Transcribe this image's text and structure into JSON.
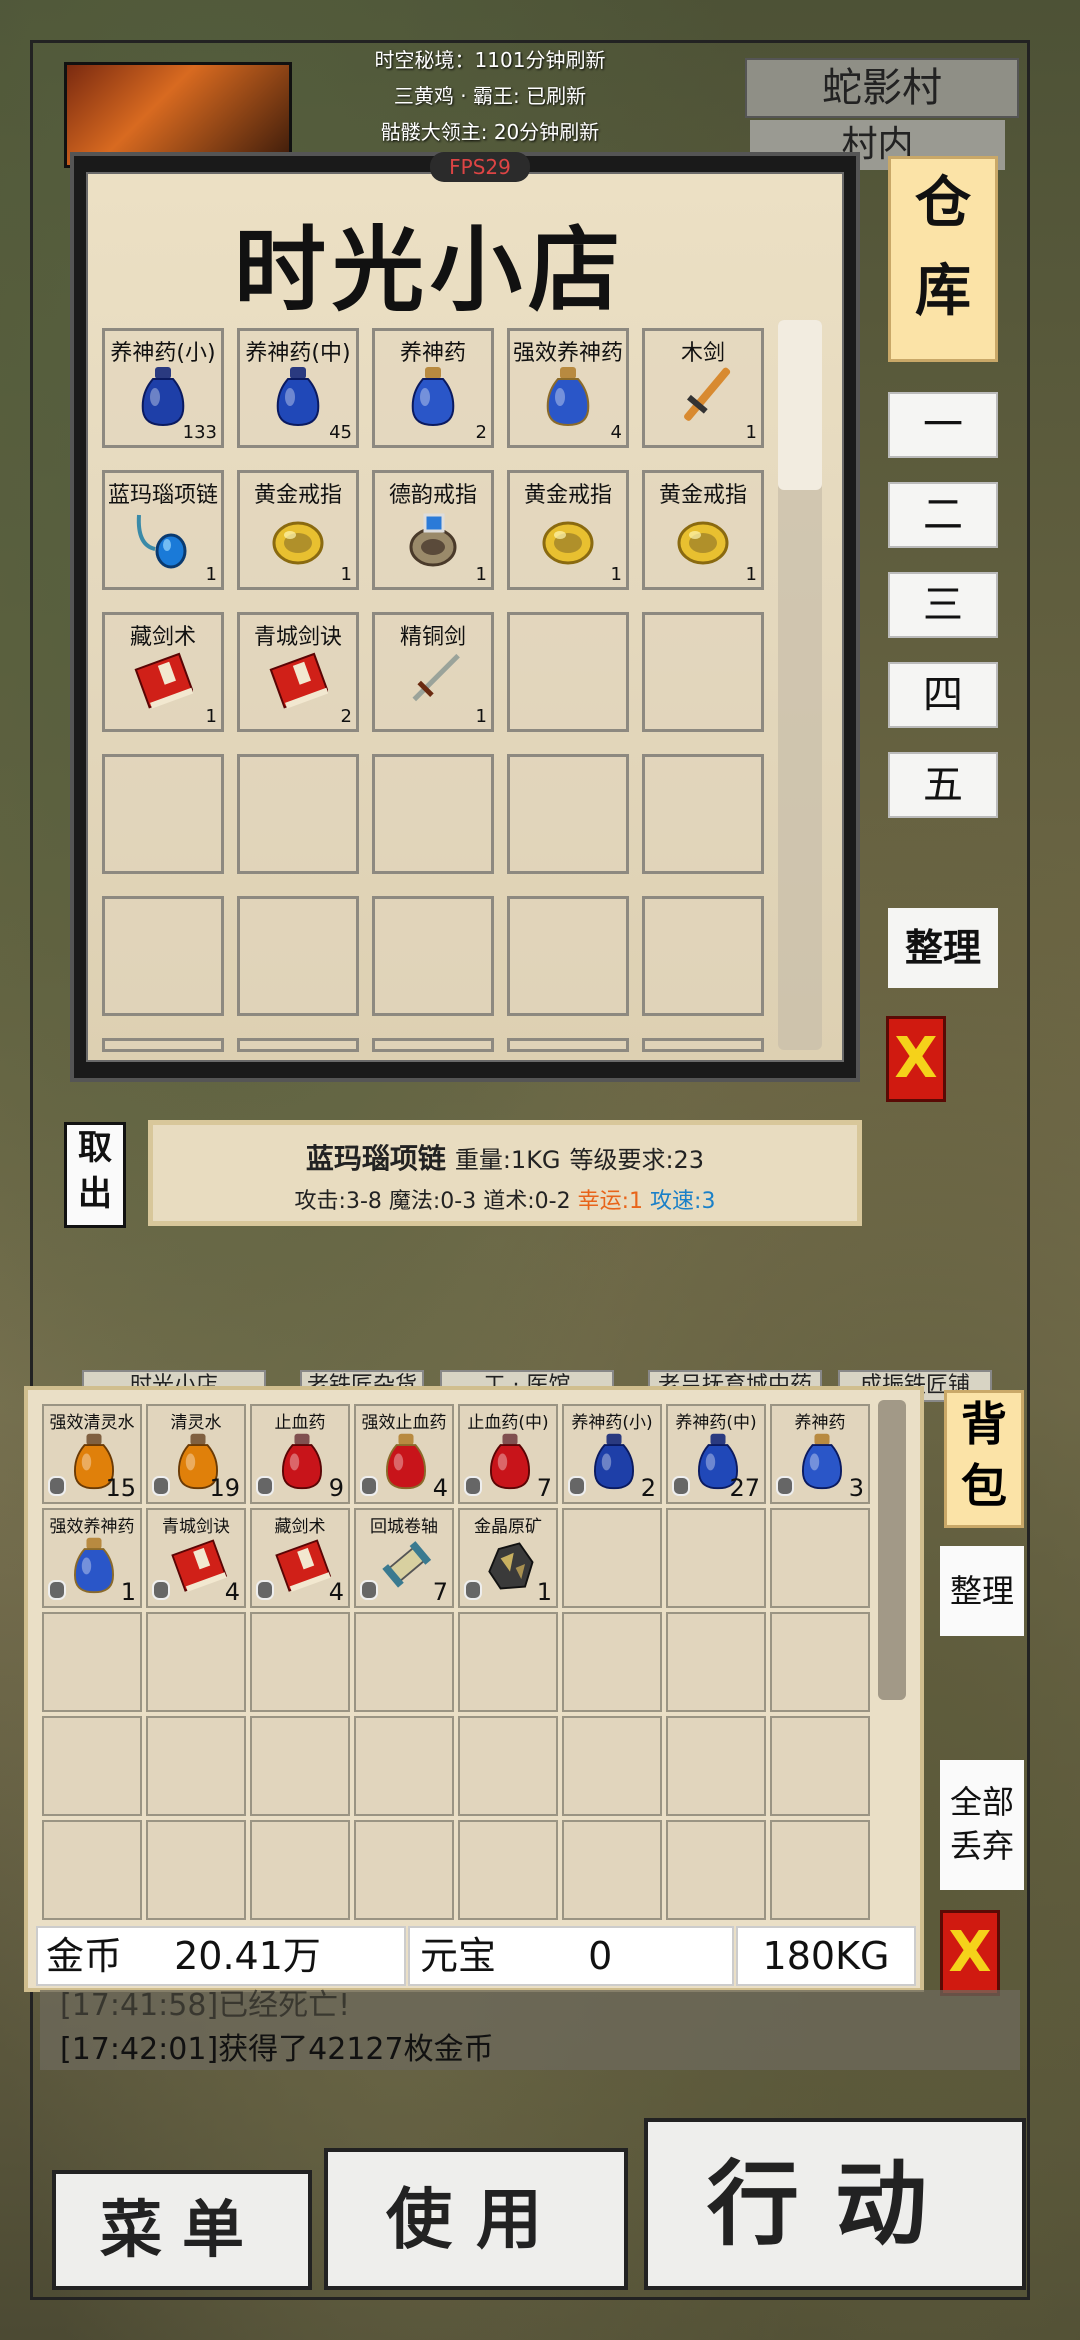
{
  "top": {
    "line1": "时空秘境：1101分钟刷新",
    "line2": "三黄鸡 · 霸王: 已刷新",
    "line3": "骷髅大领主: 20分钟刷新",
    "location": "蛇影村",
    "sub_location": "村内",
    "fps": "FPS29"
  },
  "shop": {
    "title": "时光小店",
    "items": [
      {
        "name": "养神药(小)",
        "count": "133",
        "icon": "blue-potion-small"
      },
      {
        "name": "养神药(中)",
        "count": "45",
        "icon": "blue-potion-medium"
      },
      {
        "name": "养神药",
        "count": "2",
        "icon": "blue-potion"
      },
      {
        "name": "强效养神药",
        "count": "4",
        "icon": "blue-potion-strong"
      },
      {
        "name": "木剑",
        "count": "1",
        "icon": "wooden-sword"
      },
      {
        "name": "蓝玛瑙项链",
        "count": "1",
        "icon": "agate-necklace"
      },
      {
        "name": "黄金戒指",
        "count": "1",
        "icon": "gold-ring"
      },
      {
        "name": "德韵戒指",
        "count": "1",
        "icon": "blue-gem-ring"
      },
      {
        "name": "黄金戒指",
        "count": "1",
        "icon": "gold-ring"
      },
      {
        "name": "黄金戒指",
        "count": "1",
        "icon": "gold-ring"
      },
      {
        "name": "藏剑术",
        "count": "1",
        "icon": "red-book"
      },
      {
        "name": "青城剑诀",
        "count": "2",
        "icon": "red-book"
      },
      {
        "name": "精铜剑",
        "count": "1",
        "icon": "bronze-sword"
      }
    ]
  },
  "warehouse": {
    "title": "仓库",
    "pages": [
      "一",
      "二",
      "三",
      "四",
      "五"
    ],
    "sort_label": "整理",
    "close_label": "X"
  },
  "detail": {
    "take_out": "取出",
    "item_name": "蓝玛瑙项链",
    "weight": "重量:1KG",
    "level_req": "等级要求:23",
    "attack": "攻击:3-8",
    "magic": "魔法:0-3",
    "tao": "道术:0-2",
    "luck": "幸运:1",
    "speed": "攻速:3",
    "luck_color": "#e8641a",
    "speed_color": "#1a80c8"
  },
  "tabs": [
    "时光小店",
    "老铁匠杂货店",
    "工 · 医馆",
    "老吕抚育城中药",
    "成振铁匠铺"
  ],
  "bag": {
    "title": "背包",
    "items": [
      {
        "name": "强效清灵水",
        "count": "15",
        "icon": "orange-potion"
      },
      {
        "name": "清灵水",
        "count": "19",
        "icon": "orange-potion"
      },
      {
        "name": "止血药",
        "count": "9",
        "icon": "red-potion"
      },
      {
        "name": "强效止血药",
        "count": "4",
        "icon": "red-potion-strong"
      },
      {
        "name": "止血药(中)",
        "count": "7",
        "icon": "red-potion"
      },
      {
        "name": "养神药(小)",
        "count": "2",
        "icon": "blue-potion-small"
      },
      {
        "name": "养神药(中)",
        "count": "27",
        "icon": "blue-potion-medium"
      },
      {
        "name": "养神药",
        "count": "3",
        "icon": "blue-potion"
      },
      {
        "name": "强效养神药",
        "count": "1",
        "icon": "blue-potion-strong"
      },
      {
        "name": "青城剑诀",
        "count": "4",
        "icon": "red-book"
      },
      {
        "name": "藏剑术",
        "count": "4",
        "icon": "red-book"
      },
      {
        "name": "回城卷轴",
        "count": "7",
        "icon": "scroll"
      },
      {
        "name": "金晶原矿",
        "count": "1",
        "icon": "gold-ore"
      }
    ],
    "gold_label": "金币",
    "gold_value": "20.41万",
    "yuanbao_label": "元宝",
    "yuanbao_value": "0",
    "weight": "180KG",
    "sort_label": "整理",
    "drop_all": "全部丢弃",
    "close_label": "X"
  },
  "chat": {
    "line1": "[17:41:58]已经死亡!",
    "line2": "[17:42:01]获得了42127枚金币"
  },
  "buttons": {
    "menu": "菜单",
    "use": "使用",
    "action": "行动"
  }
}
